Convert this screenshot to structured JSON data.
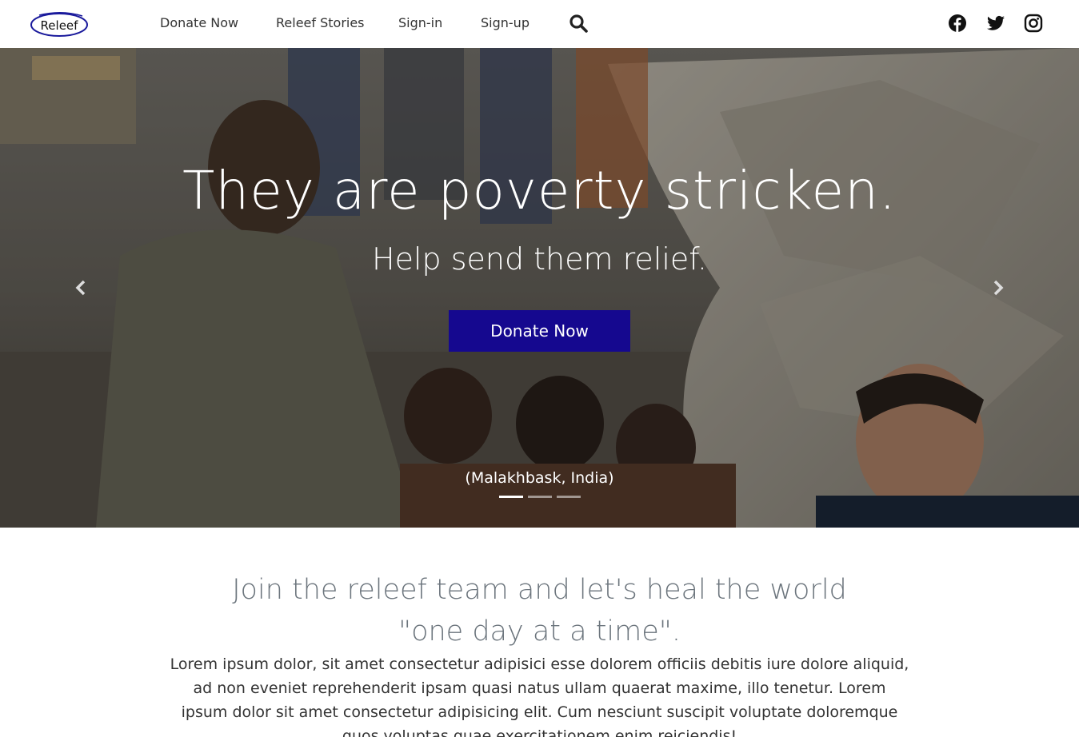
{
  "brand": {
    "logo_text": "Releef"
  },
  "nav": {
    "donate": "Donate Now",
    "stories": "Releef Stories",
    "signin": "Sign-in",
    "signup": "Sign-up"
  },
  "icons": {
    "search": "search-icon",
    "facebook": "facebook-icon",
    "twitter": "twitter-icon",
    "instagram": "instagram-icon",
    "prev": "chevron-left-icon",
    "next": "chevron-right-icon"
  },
  "hero": {
    "title": "They are poverty stricken.",
    "subtitle": "Help send them relief.",
    "button": "Donate Now",
    "caption": "(Malakhbask, India)",
    "active_slide": 1,
    "slide_count": 3
  },
  "intro": {
    "heading_line1": "Join the releef team and let's heal the world",
    "heading_line2": "\"one day at a time\".",
    "body": "Lorem ipsum dolor, sit amet consectetur adipisici esse dolorem officiis debitis iure dolore aliquid, ad non eveniet reprehenderit ipsam quasi natus ullam quaerat maxime, illo tenetur. Lorem ipsum dolor sit amet consectetur adipisicing elit. Cum nesciunt suscipit voluptate doloremque quos voluptas quae exercitationem enim reiciendis!"
  },
  "colors": {
    "accent": "#15088f",
    "heading_gray": "#6c757d"
  }
}
